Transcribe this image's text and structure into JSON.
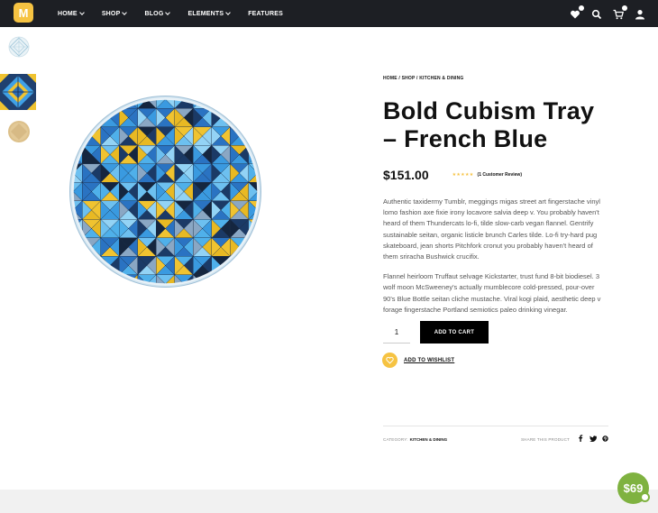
{
  "header": {
    "logo_letter": "M",
    "nav": [
      {
        "label": "HOME",
        "has_dropdown": true
      },
      {
        "label": "SHOP",
        "has_dropdown": true
      },
      {
        "label": "BLOG",
        "has_dropdown": true
      },
      {
        "label": "ELEMENTS",
        "has_dropdown": true
      },
      {
        "label": "FEATURES",
        "has_dropdown": false
      }
    ],
    "icons": [
      "heart-icon",
      "search-icon",
      "cart-icon",
      "user-icon"
    ]
  },
  "product": {
    "breadcrumb": "HOME / SHOP / KITCHEN & DINING",
    "title": "Bold Cubism Tray – French Blue",
    "price": "$151.00",
    "stars": "★★★★★",
    "review_link": "(1 Customer Review)",
    "description": [
      "Authentic taxidermy Tumblr, meggings migas street art fingerstache vinyl lomo fashion axe fixie irony locavore salvia deep v. You probably haven't heard of them Thundercats lo-fi, tilde slow-carb vegan flannel. Gentrify sustainable seitan, organic listicle brunch Carles tilde. Lo-fi try-hard pug skateboard, jean shorts Pitchfork cronut you probably haven't heard of them sriracha Bushwick crucifix.",
      "Flannel heirloom Truffaut selvage Kickstarter, trust fund 8-bit biodiesel. 3 wolf moon McSweeney's actually mumblecore cold-pressed, pour-over 90's Blue Bottle seitan cliche mustache. Viral kogi plaid, aesthetic deep v forage fingerstache Portland semiotics paleo drinking vinegar."
    ],
    "quantity": "1",
    "add_to_cart": "ADD TO CART",
    "wishlist": "ADD TO WISHLIST",
    "category_label": "CATEGORY:",
    "category_value": "KITCHEN & DINING",
    "share_label": "SHARE THIS PRODUCT",
    "share_icons": [
      "facebook-icon",
      "twitter-icon",
      "pinterest-icon"
    ]
  },
  "promo": {
    "label": "$69"
  },
  "colors": {
    "accent": "#f6c342",
    "header_bg": "#1d1f24",
    "promo": "#7fb240",
    "tray_blue": "#4a9fe0"
  }
}
